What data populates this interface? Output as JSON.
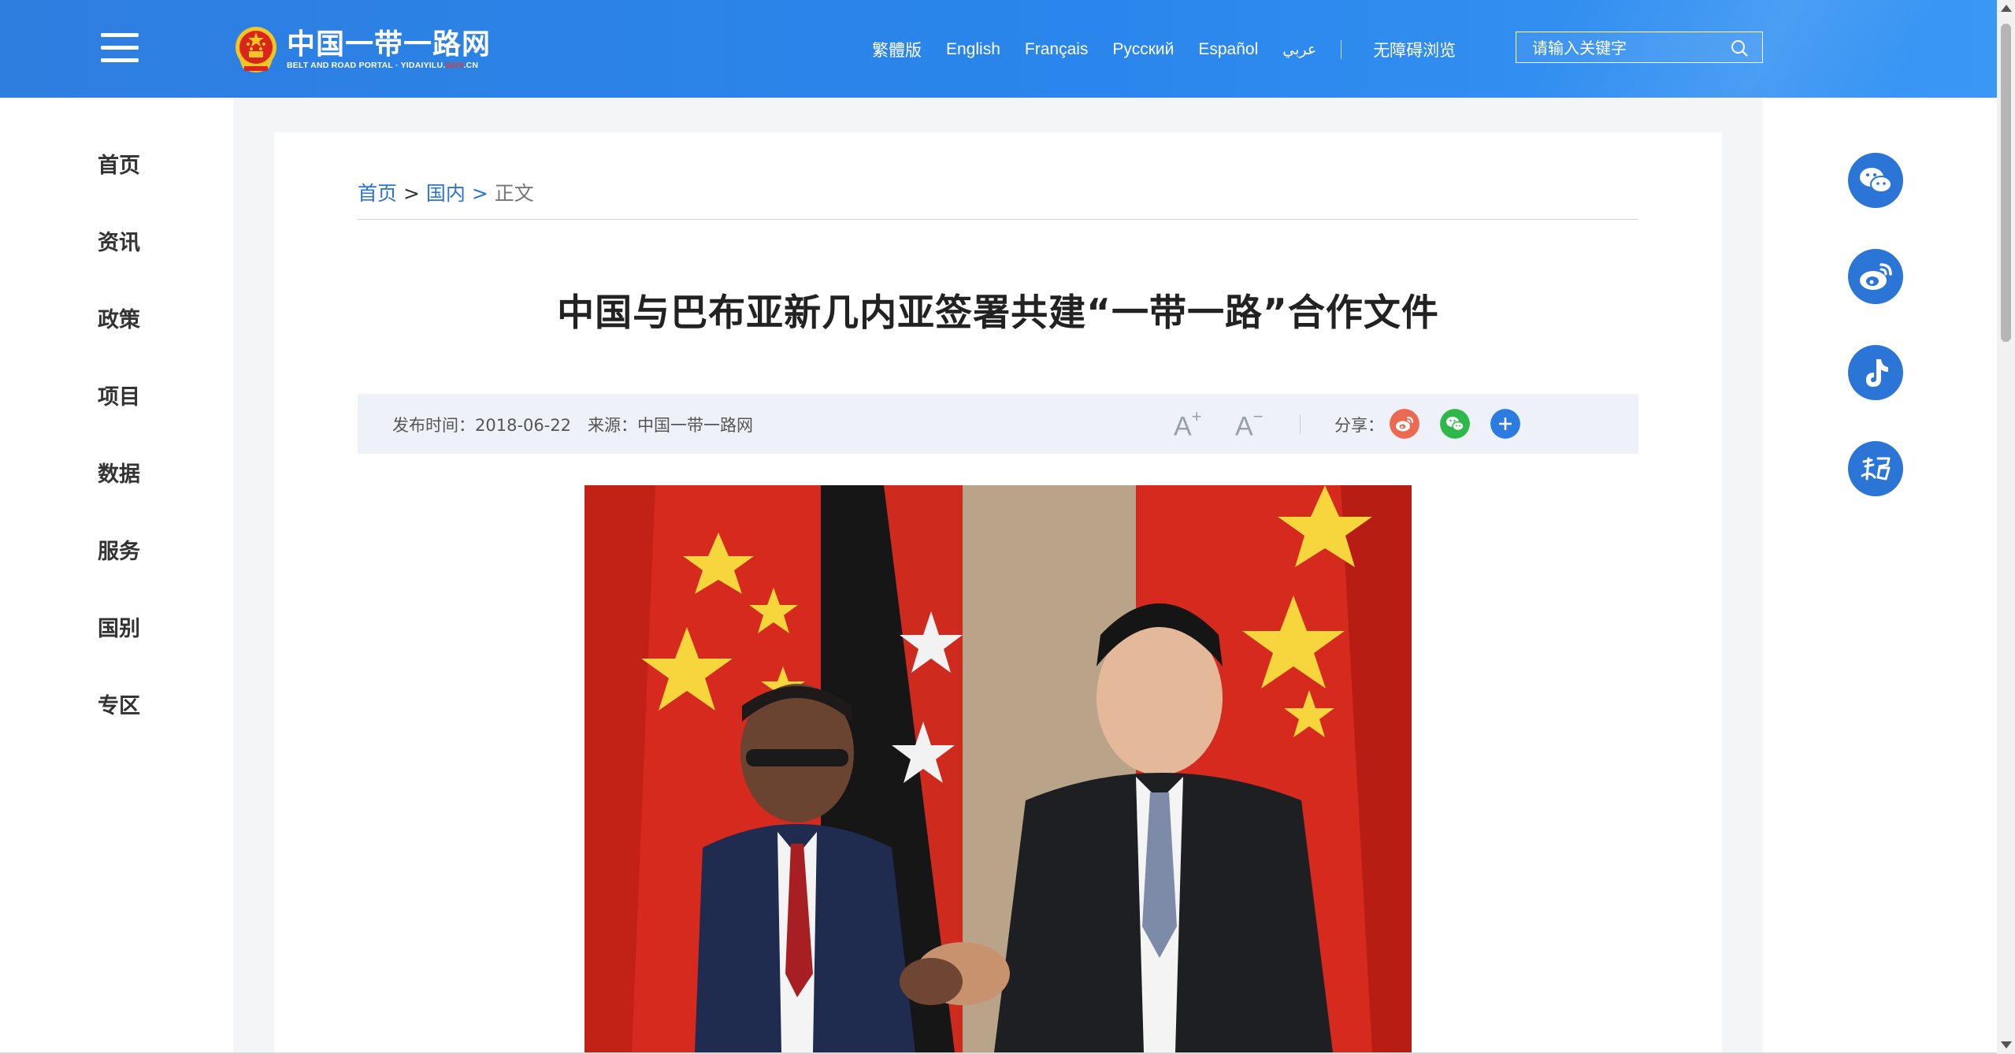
{
  "header": {
    "logo_cn": "中国一带一路网",
    "logo_en_pre": "BELT AND ROAD PORTAL · YIDAIYILU.",
    "logo_en_gov": "GOV",
    "logo_en_post": ".CN",
    "languages": [
      "繁體版",
      "English",
      "Français",
      "Русский",
      "Español",
      "عربي"
    ],
    "accessibility": "无障碍浏览",
    "search_placeholder": "请输入关键字"
  },
  "nav": {
    "items": [
      "首页",
      "资讯",
      "政策",
      "项目",
      "数据",
      "服务",
      "国别",
      "专区"
    ]
  },
  "breadcrumb": {
    "home": "首页",
    "sep": ">",
    "section": "国内",
    "current": "正文"
  },
  "article": {
    "title": "中国与巴布亚新几内亚签署共建“一带一路”合作文件",
    "publish_label": "发布时间：",
    "publish_date": "2018-06-22",
    "source_label": "来源：",
    "source": "中国一带一路网",
    "font_larger": "A",
    "font_larger_sup": "+",
    "font_smaller": "A",
    "font_smaller_sup": "−",
    "share_label": "分享："
  },
  "icons": {
    "share": [
      "weibo-icon",
      "wechat-icon",
      "more-plus-icon"
    ],
    "floating": [
      "wechat-icon",
      "weibo-icon",
      "douyin-icon",
      "xuexi-icon"
    ]
  },
  "colors": {
    "header": "#2a86ec",
    "link": "#2b73d6",
    "floating": "#2a75d6",
    "weibo": "#e95b45",
    "wechat": "#2fb84a"
  }
}
